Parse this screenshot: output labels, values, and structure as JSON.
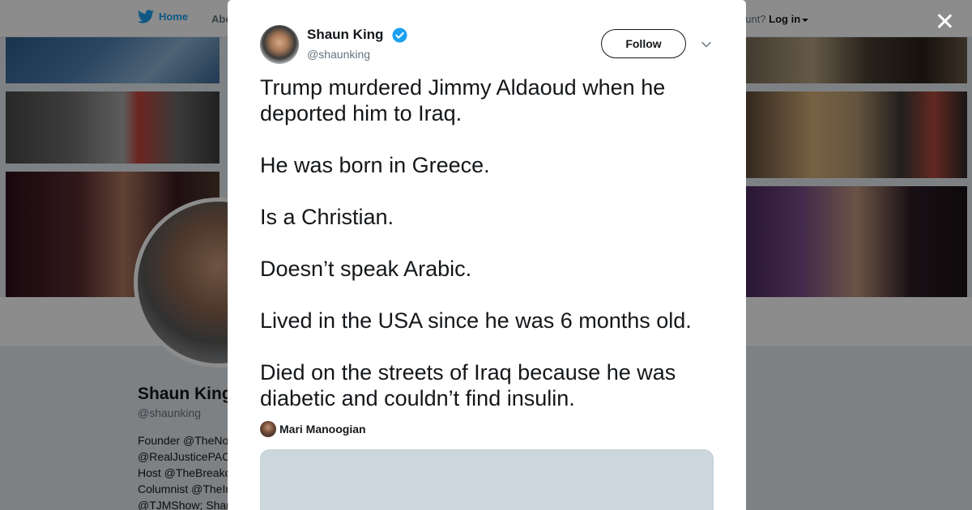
{
  "nav": {
    "home_label": "Home",
    "about_label": "Abo",
    "account_prompt": "ccount?",
    "login_label": "Log in"
  },
  "profile": {
    "name": "Shaun King",
    "handle": "@shaunking",
    "bio": [
      "Founder @TheNo",
      "@RealJusticePAC",
      "Host @TheBreako",
      "Columnist @TheIn",
      "@TJMShow; Shar"
    ]
  },
  "tweet": {
    "author_name": "Shaun King",
    "author_handle": "@shaunking",
    "follow_label": "Follow",
    "paragraphs": [
      "Trump murdered Jimmy Aldaoud when he deported him to Iraq.",
      "He was born in Greece.",
      "Is a Christian.",
      "Doesn’t speak Arabic.",
      "Lived in the USA since he was 6 months old.",
      "Died on the streets of Iraq because he was diabetic and couldn’t find insulin."
    ],
    "mentioned_user": "Mari Manoogian"
  },
  "icons": {
    "twitter": "bird-icon",
    "verified": "verified-badge-icon",
    "menu": "chevron-down-icon",
    "close": "close-icon"
  },
  "colors": {
    "brand": "#1da1f2",
    "overlay": "rgba(0,0,0,0.45)",
    "media_placeholder": "#ccd6dd"
  }
}
